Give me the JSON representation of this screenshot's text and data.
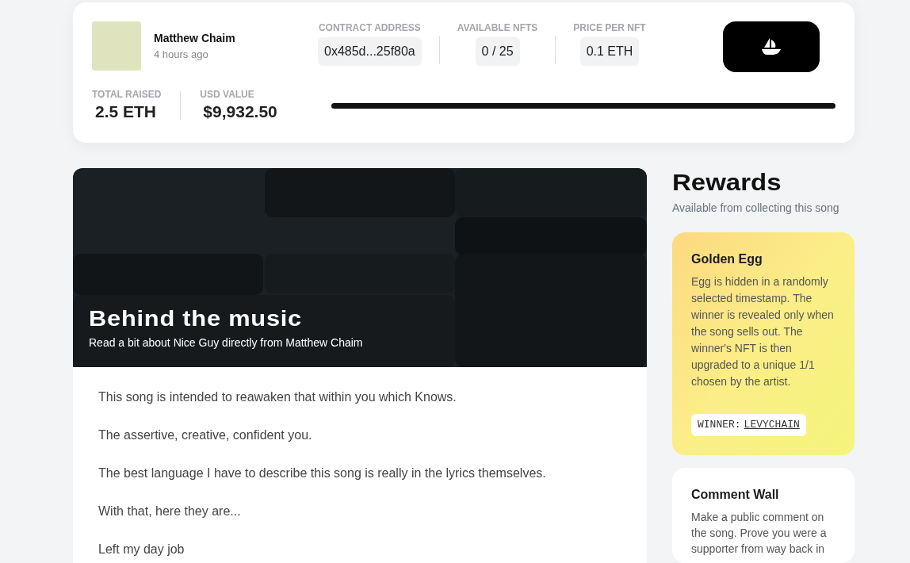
{
  "artist": {
    "name": "Matthew Chaim",
    "time": "4 hours ago"
  },
  "stats": [
    {
      "label": "CONTRACT ADDRESS",
      "value": "0x485d...25f80a"
    },
    {
      "label": "AVAILABLE NFTS",
      "value": "0 / 25"
    },
    {
      "label": "PRICE PER NFT",
      "value": "0.1 ETH"
    }
  ],
  "totals": [
    {
      "label": "TOTAL RAISED",
      "value": "2.5 ETH"
    },
    {
      "label": "USD VALUE",
      "value": "$9,932.50"
    }
  ],
  "progress": {
    "level": 1
  },
  "story": {
    "title": "Behind the music",
    "subtitle": "Read a bit about Nice Guy directly from Matthew Chaim",
    "paragraphs": [
      "This song is intended to reawaken that within you which Knows.",
      "The assertive, creative, confident you.",
      "The best language I have to describe this song is really in the lyrics themselves.",
      "With that, here they are...",
      "Left my day job"
    ]
  },
  "rewards": {
    "title": "Rewards",
    "subtitle": "Available from collecting this song",
    "cards": [
      {
        "kind": "golden",
        "title": "Golden Egg",
        "text": "Egg is hidden in a randomly selected timestamp. The winner is revealed only when the song sells out. The winner's NFT is then upgraded to a unique 1/1 chosen by the artist.",
        "winner_label": "WINNER:",
        "winner": "LEVYCHAIN"
      },
      {
        "kind": "plain",
        "title": "Comment Wall",
        "text": "Make a public comment on the song. Prove you were a supporter from way back in"
      }
    ]
  }
}
